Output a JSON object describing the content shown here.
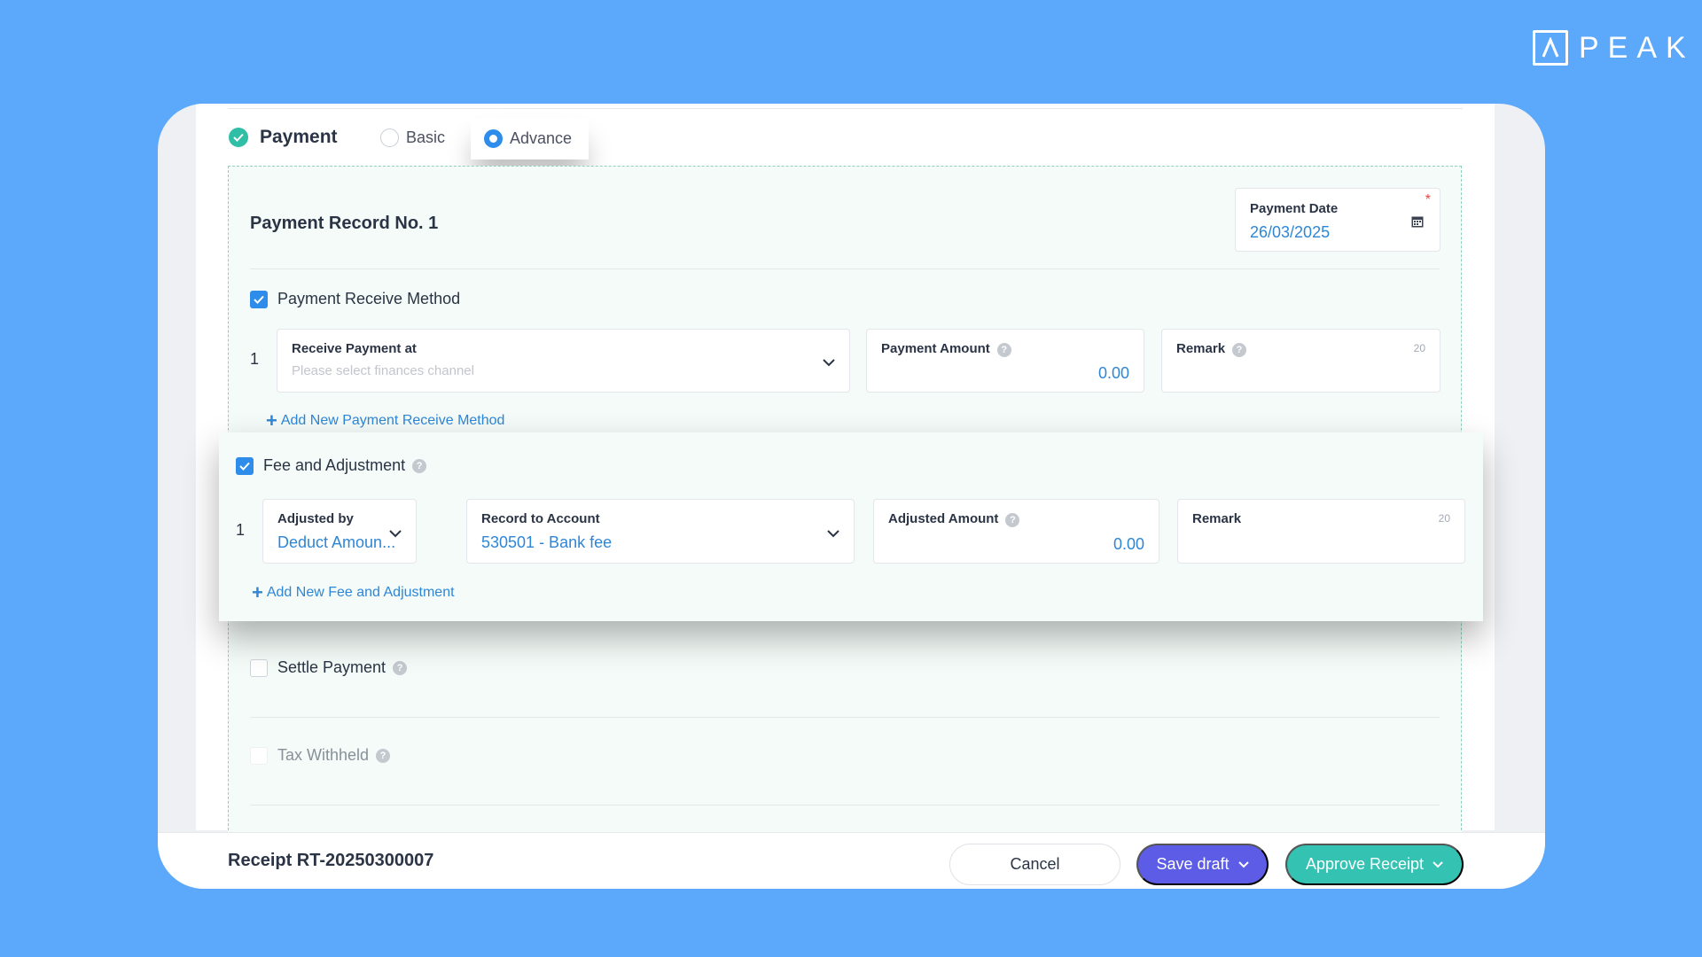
{
  "brand": {
    "name": "PEAK"
  },
  "payment": {
    "title": "Payment",
    "modes": {
      "basic": "Basic",
      "advance": "Advance",
      "selected": "Advance"
    }
  },
  "record": {
    "title": "Payment Record No. 1",
    "payment_date": {
      "label": "Payment Date",
      "value": "26/03/2025",
      "required_mark": "*"
    }
  },
  "receive_method": {
    "label": "Payment Receive Method",
    "checked": true,
    "row_number": "1",
    "receive_at": {
      "label": "Receive Payment at",
      "placeholder": "Please select finances channel"
    },
    "amount": {
      "label": "Payment Amount",
      "value": "0.00"
    },
    "remark": {
      "label": "Remark",
      "counter": "20"
    },
    "add_link": "Add New Payment Receive Method"
  },
  "fee": {
    "label": "Fee and Adjustment",
    "checked": true,
    "row_number": "1",
    "adjusted_by": {
      "label": "Adjusted by",
      "value": "Deduct Amoun..."
    },
    "account": {
      "label": "Record to Account",
      "value": "530501 - Bank fee"
    },
    "amount": {
      "label": "Adjusted Amount",
      "value": "0.00"
    },
    "remark": {
      "label": "Remark",
      "counter": "20"
    },
    "add_link": "Add New Fee and Adjustment"
  },
  "settle": {
    "label": "Settle Payment",
    "checked": false
  },
  "tax": {
    "label": "Tax Withheld",
    "checked": false
  },
  "footer": {
    "receipt_no": "Receipt RT-20250300007",
    "cancel": "Cancel",
    "save_draft": "Save draft",
    "approve": "Approve Receipt"
  },
  "colors": {
    "background": "#5ca8fa",
    "accent_blue": "#2e8dea",
    "draft_purple": "#5c5ce6",
    "approve_teal": "#34c2b3",
    "success_green": "#2fbfa6"
  }
}
